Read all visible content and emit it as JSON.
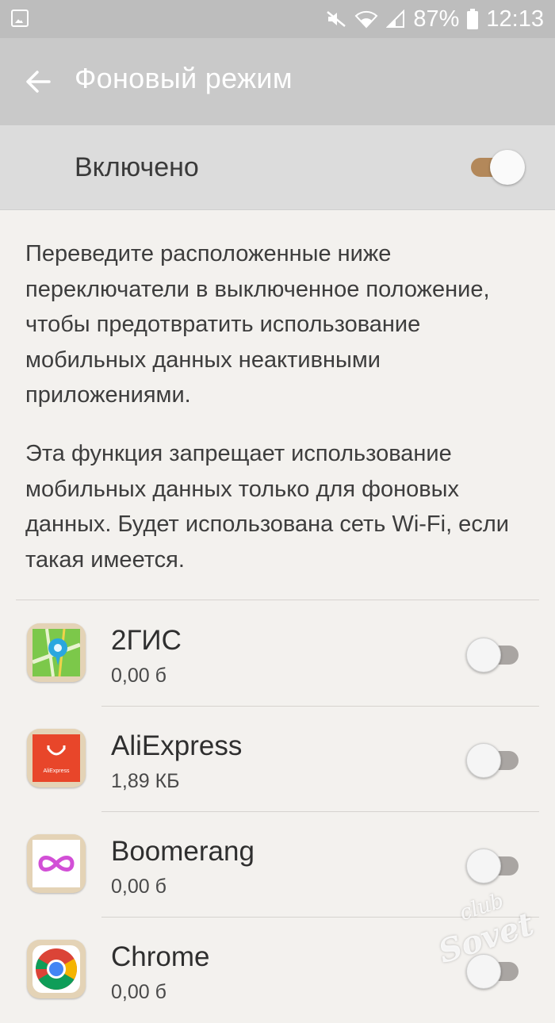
{
  "status_bar": {
    "battery_percent": "87%",
    "time": "12:13",
    "icons": [
      "gallery-icon",
      "mute-icon",
      "wifi-icon",
      "signal-icon",
      "battery-icon"
    ]
  },
  "app_bar": {
    "title": "Фоновый режим",
    "back_icon": "arrow-left-icon"
  },
  "master_toggle": {
    "label": "Включено",
    "state": true,
    "accent_color": "#b3885a"
  },
  "description": {
    "paragraph1": "Переведите расположенные ниже переключатели в выключенное положение, чтобы предотвратить использование мобильных данных неактивными приложениями.",
    "paragraph2": "Эта функция запрещает использование мобильных данных только для фоновых данных. Будет использована сеть Wi-Fi, если такая имеется."
  },
  "apps": [
    {
      "name": "2ГИС",
      "size": "0,00 б",
      "enabled": false,
      "icon": "2gis-icon"
    },
    {
      "name": "AliExpress",
      "size": "1,89 КБ",
      "enabled": false,
      "icon": "aliexpress-icon",
      "icon_caption": "AliExpress"
    },
    {
      "name": "Boomerang",
      "size": "0,00 б",
      "enabled": false,
      "icon": "boomerang-icon"
    },
    {
      "name": "Chrome",
      "size": "0,00 б",
      "enabled": false,
      "icon": "chrome-icon"
    }
  ],
  "watermark": {
    "line1": "club",
    "line2": "Sovet"
  }
}
